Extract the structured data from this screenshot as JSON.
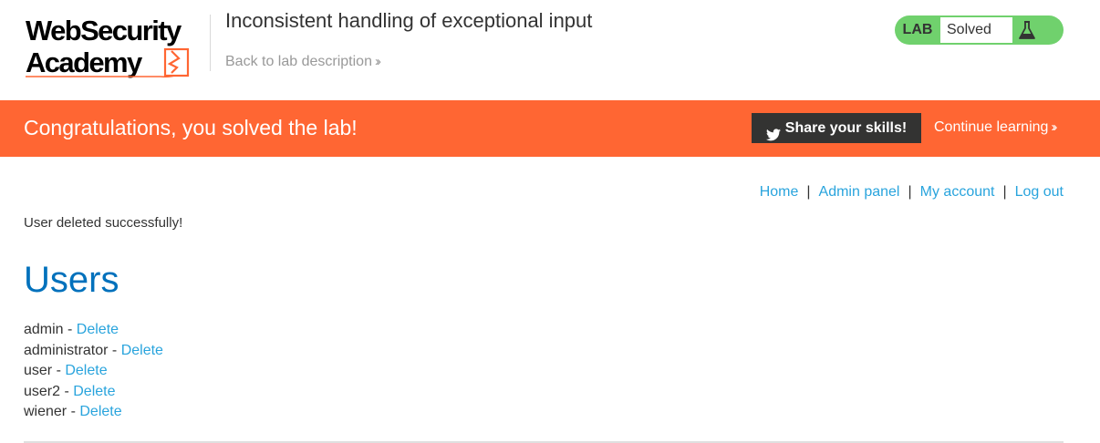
{
  "header": {
    "logo_line1": "WebSecurity",
    "logo_line2": "Academy",
    "lab_title": "Inconsistent handling of exceptional input",
    "back_link": "Back to lab description",
    "lab_badge": {
      "label": "LAB",
      "status": "Solved",
      "icon": "flask-icon",
      "color": "#70d16d"
    }
  },
  "banner": {
    "title": "Congratulations, you solved the lab!",
    "share_label": "Share your skills!",
    "share_icon": "twitter-icon",
    "continue_label": "Continue learning",
    "color": "#ff6633"
  },
  "nav": {
    "items": [
      "Home",
      "Admin panel",
      "My account",
      "Log out"
    ],
    "separator": "|"
  },
  "message": "User deleted successfully!",
  "users": {
    "heading": "Users",
    "separator": " - ",
    "delete_label": "Delete",
    "list": [
      "admin",
      "administrator",
      "user",
      "user2",
      "wiener"
    ]
  },
  "colors": {
    "link": "#29a4dd",
    "heading": "#0071bc",
    "text": "#333333"
  }
}
